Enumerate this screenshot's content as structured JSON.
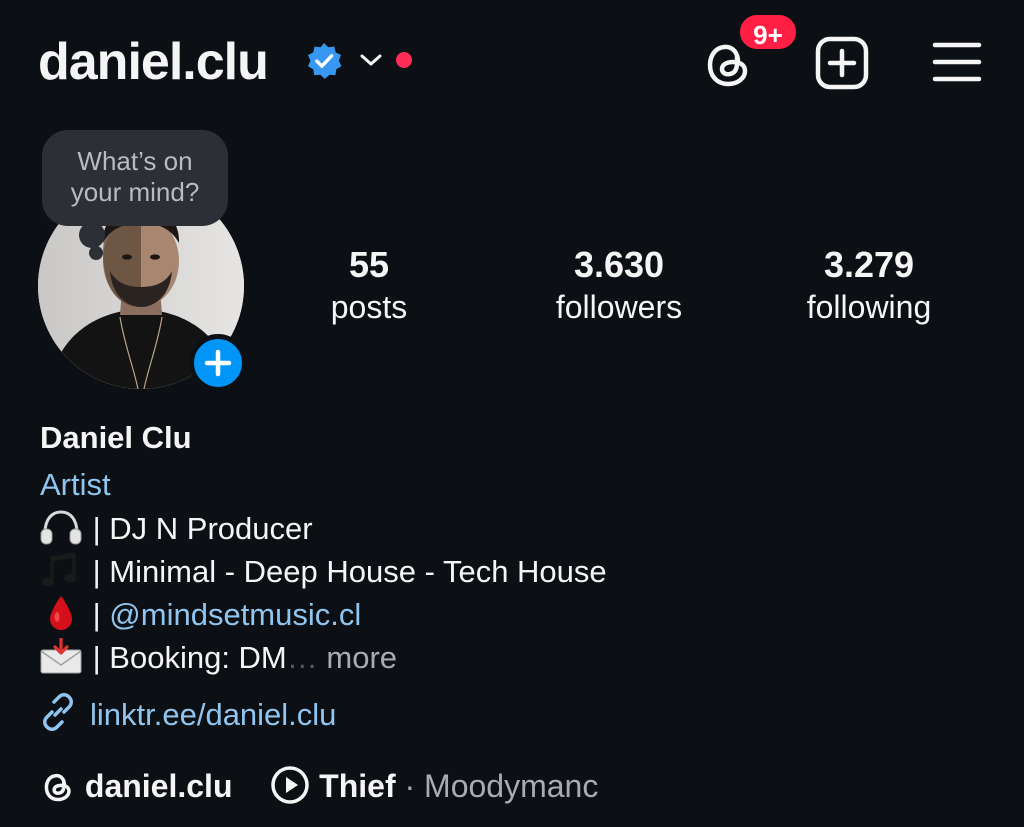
{
  "header": {
    "username": "daniel.clu",
    "threads_badge": "9+"
  },
  "profile": {
    "note_prompt": "What’s on your mind?",
    "stats": [
      {
        "value": "55",
        "label": "posts"
      },
      {
        "value": "3.630",
        "label": "followers"
      },
      {
        "value": "3.279",
        "label": "following"
      }
    ],
    "full_name": "Daniel Clu",
    "category": "Artist",
    "bio": {
      "line1": "| DJ N Producer",
      "line2": "| Minimal - Deep House - Tech House",
      "line3_prefix": "| ",
      "line3_mention": "@mindsetmusic.cl",
      "line4": "| Booking: DM",
      "ellipsis": "…",
      "more": " more"
    },
    "link": "linktr.ee/daniel.clu",
    "threads_handle": "daniel.clu",
    "music": {
      "song": "Thief",
      "separator": " · ",
      "artist": "Moodymanc"
    }
  },
  "colors": {
    "background": "#0c0f14",
    "link_blue": "#8fc5ee",
    "verified_blue": "#3897f0",
    "badge_red": "#ff1f45",
    "add_blue": "#0095f6"
  },
  "icons": {
    "verified": "verified-badge-icon",
    "chevron": "chevron-down-icon",
    "threads": "threads-icon",
    "create": "plus-square-icon",
    "menu": "hamburger-menu-icon",
    "add_story": "plus-icon",
    "link": "link-icon",
    "play": "play-circle-icon",
    "bio_emoji": [
      "headphones-icon",
      "music-notes-icon",
      "drop-of-blood-icon",
      "envelope-arrow-icon"
    ]
  }
}
